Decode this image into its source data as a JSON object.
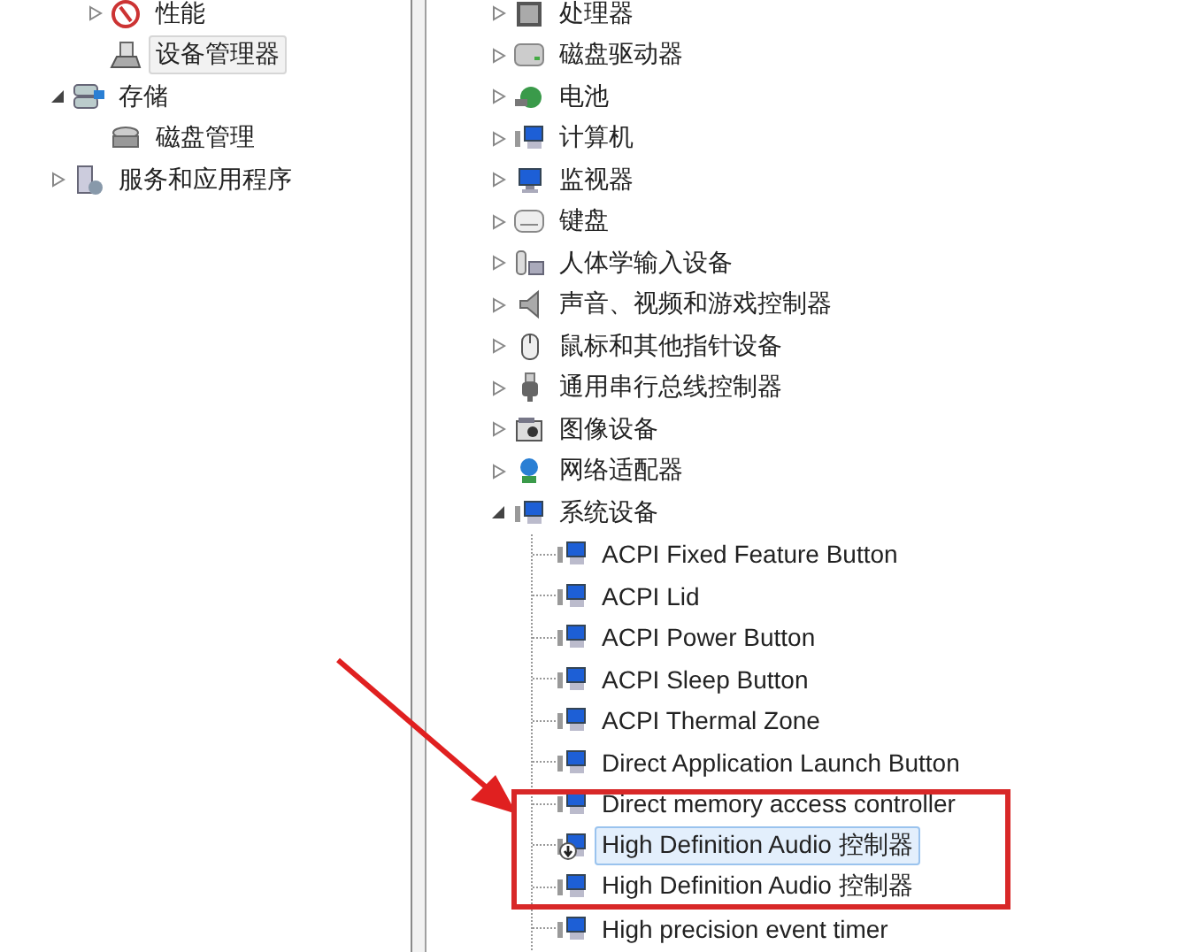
{
  "left_tree": {
    "continued_items": [
      {
        "label": "性能",
        "expanded": false,
        "selected": false
      },
      {
        "label": "设备管理器",
        "selected": true
      }
    ],
    "items": [
      {
        "label": "存储",
        "expanded": true,
        "selected": false,
        "children": [
          {
            "label": "磁盘管理",
            "selected": false
          }
        ]
      },
      {
        "label": "服务和应用程序",
        "expanded": false,
        "selected": false
      }
    ]
  },
  "device_tree": {
    "items": [
      {
        "label": "处理器",
        "expanded": false
      },
      {
        "label": "磁盘驱动器",
        "expanded": false
      },
      {
        "label": "电池",
        "expanded": false
      },
      {
        "label": "计算机",
        "expanded": false
      },
      {
        "label": "监视器",
        "expanded": false
      },
      {
        "label": "键盘",
        "expanded": false
      },
      {
        "label": "人体学输入设备",
        "expanded": false
      },
      {
        "label": "声音、视频和游戏控制器",
        "expanded": false
      },
      {
        "label": "鼠标和其他指针设备",
        "expanded": false
      },
      {
        "label": "通用串行总线控制器",
        "expanded": false
      },
      {
        "label": "图像设备",
        "expanded": false
      },
      {
        "label": "网络适配器",
        "expanded": false
      },
      {
        "label": "系统设备",
        "expanded": true,
        "children": [
          {
            "label": "ACPI Fixed Feature Button",
            "selected": false,
            "disabled": false
          },
          {
            "label": "ACPI Lid",
            "selected": false,
            "disabled": false
          },
          {
            "label": "ACPI Power Button",
            "selected": false,
            "disabled": false
          },
          {
            "label": "ACPI Sleep Button",
            "selected": false,
            "disabled": false
          },
          {
            "label": "ACPI Thermal Zone",
            "selected": false,
            "disabled": false
          },
          {
            "label": "Direct Application Launch Button",
            "selected": false,
            "disabled": false
          },
          {
            "label": "Direct memory access controller",
            "selected": false,
            "disabled": false
          },
          {
            "label": "High Definition Audio 控制器",
            "selected": true,
            "disabled": true
          },
          {
            "label": "High Definition Audio 控制器",
            "selected": false,
            "disabled": false
          },
          {
            "label": "High precision event timer",
            "selected": false,
            "disabled": false
          }
        ]
      }
    ]
  }
}
